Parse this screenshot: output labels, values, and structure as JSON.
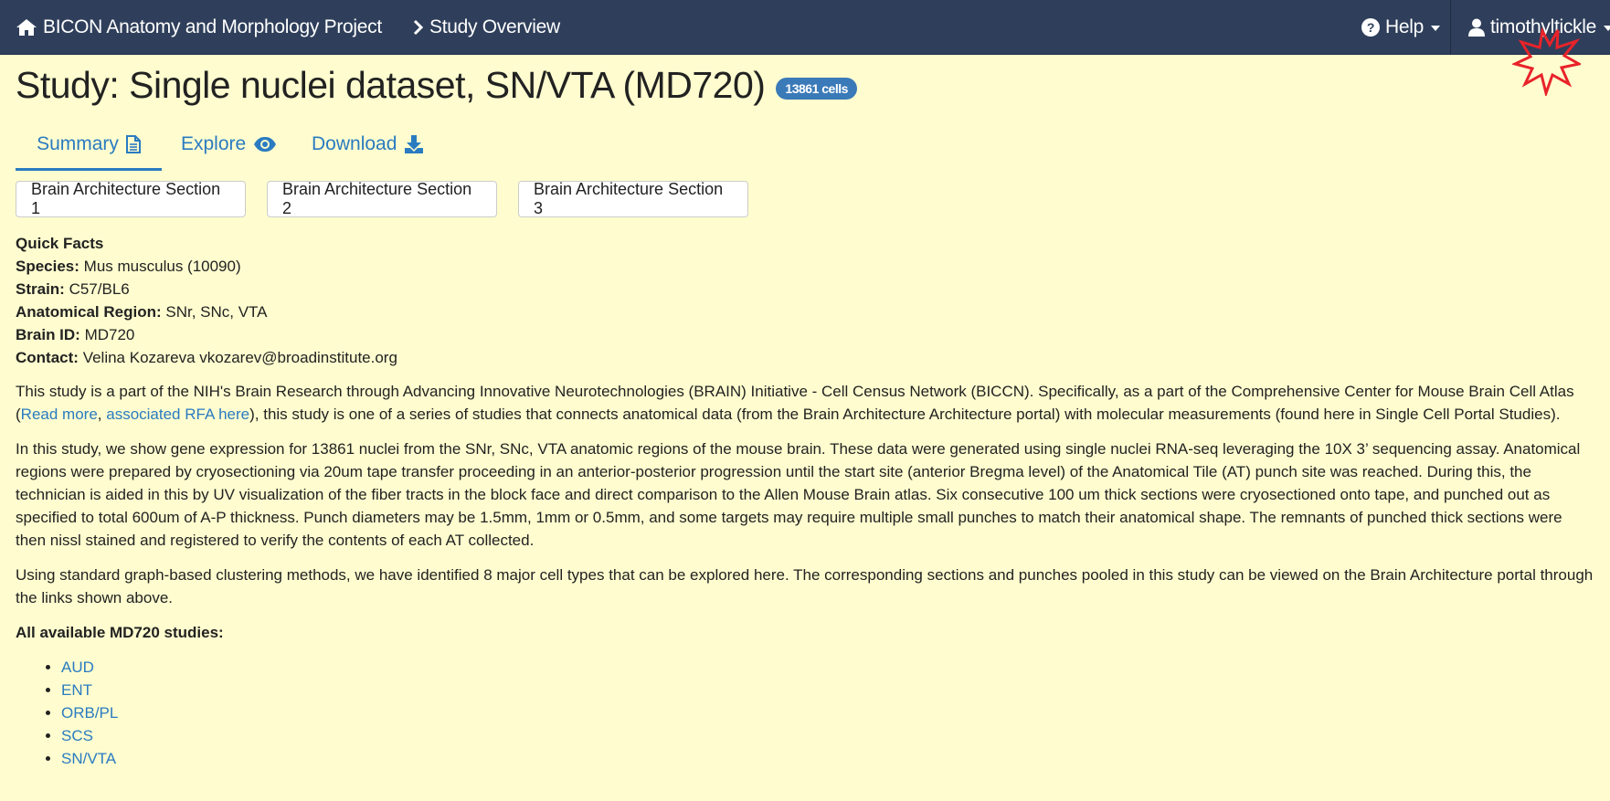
{
  "nav": {
    "brand": "BICON Anatomy and Morphology Project",
    "breadcrumb": "Study Overview",
    "help": "Help",
    "user": "timothyltickle"
  },
  "title": {
    "text": "Study: Single nuclei dataset, SN/VTA (MD720)",
    "badge": "13861 cells"
  },
  "tabs": [
    {
      "label": "Summary",
      "icon": "file-text-icon",
      "active": true
    },
    {
      "label": "Explore",
      "icon": "eye-icon"
    },
    {
      "label": "Download",
      "icon": "download-icon"
    }
  ],
  "sections": [
    "Brain Architecture Section 1",
    "Brain Architecture Section 2",
    "Brain Architecture Section 3"
  ],
  "facts": {
    "title": "Quick Facts",
    "species_label": "Species:",
    "species": "Mus musculus (10090)",
    "strain_label": "Strain:",
    "strain": "C57/BL6",
    "region_label": "Anatomical Region:",
    "region": "SNr, SNc, VTA",
    "brain_label": "Brain ID:",
    "brain": "MD720",
    "contact_label": "Contact:",
    "contact": "Velina Kozareva vkozarev@broadinstitute.org"
  },
  "para1": {
    "a": "This study is a part of the NIH's Brain Research through Advancing Innovative Neurotechnologies (BRAIN) Initiative - Cell Census Network (BICCN). Specifically, as a part of the Comprehensive Center for Mouse Brain Cell Atlas (",
    "link1": "Read more",
    "sep": ", ",
    "link2": "associated RFA here",
    "b": "), this study is one of a series of studies that connects anatomical data (from the Brain Architecture Architecture portal) with molecular measurements (found here in Single Cell Portal Studies)."
  },
  "para2": "In this study, we show gene expression for 13861 nuclei from the SNr, SNc, VTA anatomic regions of the mouse brain. These data were generated using single nuclei RNA-seq leveraging the 10X 3’ sequencing assay. Anatomical regions were prepared by cryosectioning via 20um tape transfer proceeding in an anterior-posterior progression until the start site (anterior Bregma level) of the Anatomical Tile (AT) punch site was reached. During this, the technician is aided in this by UV visualization of the fiber tracts in the block face and direct comparison to the Allen Mouse Brain atlas. Six consecutive 100 um thick sections were cryosectioned onto tape, and punched out as specified to total 600um of A-P thickness. Punch diameters may be 1.5mm, 1mm or 0.5mm, and some targets may require multiple small punches to match their anatomical shape.  The remnants of punched thick sections were then nissl stained and registered to verify the contents of each AT collected.",
  "para3": "Using standard graph-based clustering methods, we have identified 8 major cell types that can be explored here. The corresponding sections and punches pooled in this study can be viewed on the Brain Architecture portal through the links shown above.",
  "studies": {
    "title": "All available MD720 studies:",
    "items": [
      "AUD",
      "ENT",
      "ORB/PL",
      "SCS",
      "SN/VTA"
    ]
  }
}
